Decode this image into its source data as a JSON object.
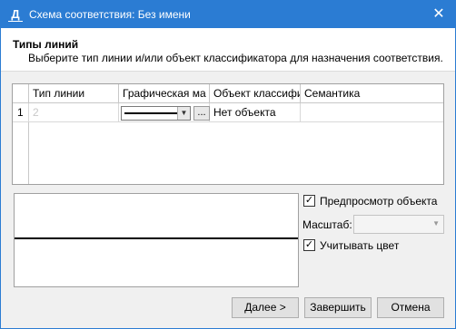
{
  "window": {
    "app_icon": "Д",
    "title": "Схема соответствия: Без имени",
    "close_glyph": "✕"
  },
  "header": {
    "title": "Типы линий",
    "subtitle": "Выберите тип линии и/или объект классификатора для назначения соответствия."
  },
  "grid": {
    "columns": [
      "Тип линии",
      "Графическая ма",
      "Объект классифи",
      "Семантика"
    ],
    "rows": [
      {
        "index": "1",
        "type": "2",
        "graphic": "solid-line",
        "object": "Нет объекта",
        "semantics": ""
      }
    ],
    "dots_label": "..."
  },
  "preview": {
    "checkbox_label": "Предпросмотр объекта",
    "checkbox_checked": true,
    "scale_label": "Масштаб:",
    "scale_value": "",
    "color_label": "Учитывать цвет",
    "color_checked": true
  },
  "buttons": {
    "next": "Далее >",
    "finish": "Завершить",
    "cancel": "Отмена"
  },
  "colors": {
    "titlebar": "#2b7cd3",
    "accent": "#2b7cd3"
  }
}
